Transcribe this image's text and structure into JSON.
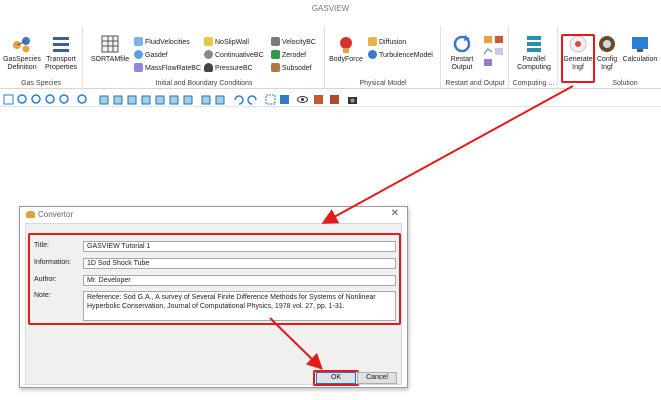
{
  "app": {
    "title": "GASVIEW"
  },
  "ribbon": {
    "groups": {
      "gas_species": {
        "label": "Gas Species",
        "btn1": "GasSpecies\nDefinition",
        "btn2": "Transport\nProperties"
      },
      "initial_bc": {
        "label": "Initial and Boundary Conditions",
        "sortam": "SORTAMfile",
        "col1": [
          "FluidVelocities",
          "Gasdef",
          "MassFlowRateBC"
        ],
        "col2": [
          "NoSlipWall",
          "ContinuativeBC",
          "PressureBC"
        ],
        "col3": [
          "VelocityBC",
          "Zerodef",
          "Subsodef"
        ]
      },
      "physical_model": {
        "label": "Physical Model",
        "bodyforce": "BodyForce",
        "diffusion": "Diffusion",
        "turbulence": "TurbulenceModel"
      },
      "restart_output": {
        "label": "Restart and Output",
        "btn": "Restart\nOutput"
      },
      "computing": {
        "label": "Computing ...",
        "btn": "Parallel\nComputing"
      },
      "solution": {
        "label": "Solution",
        "generate": "Generate\nIngf",
        "config": "Config\nIngf",
        "calculation": "Calculation"
      }
    }
  },
  "dialog": {
    "title": "Convertor",
    "close_glyph": "✕",
    "fields": {
      "title": {
        "label": "Title:",
        "value": "GASVIEW Tutorial 1"
      },
      "information": {
        "label": "Information:",
        "value": "1D Sod Shock Tube"
      },
      "author": {
        "label": "Author:",
        "value": "Mr. Developer"
      },
      "note": {
        "label": "Note:",
        "value": "Reference: Sod G.A., A survey of Several Finite Difference Methods for Systems of Nonlinear Hyperbolic Conservation, Journal of Computational Physics, 1978 vol. 27, pp. 1-31."
      }
    },
    "ok_label": "OK",
    "cancel_label": "Cancel"
  },
  "colors": {
    "highlight": "#e11a1a",
    "accent": "#2a6fd6"
  },
  "icons": [
    "molecule-icon",
    "transport-icon",
    "sortam-grid-icon",
    "bodyforce-icon",
    "restart-icon",
    "parallel-icon",
    "generate-icon",
    "config-icon",
    "calculation-icon"
  ]
}
